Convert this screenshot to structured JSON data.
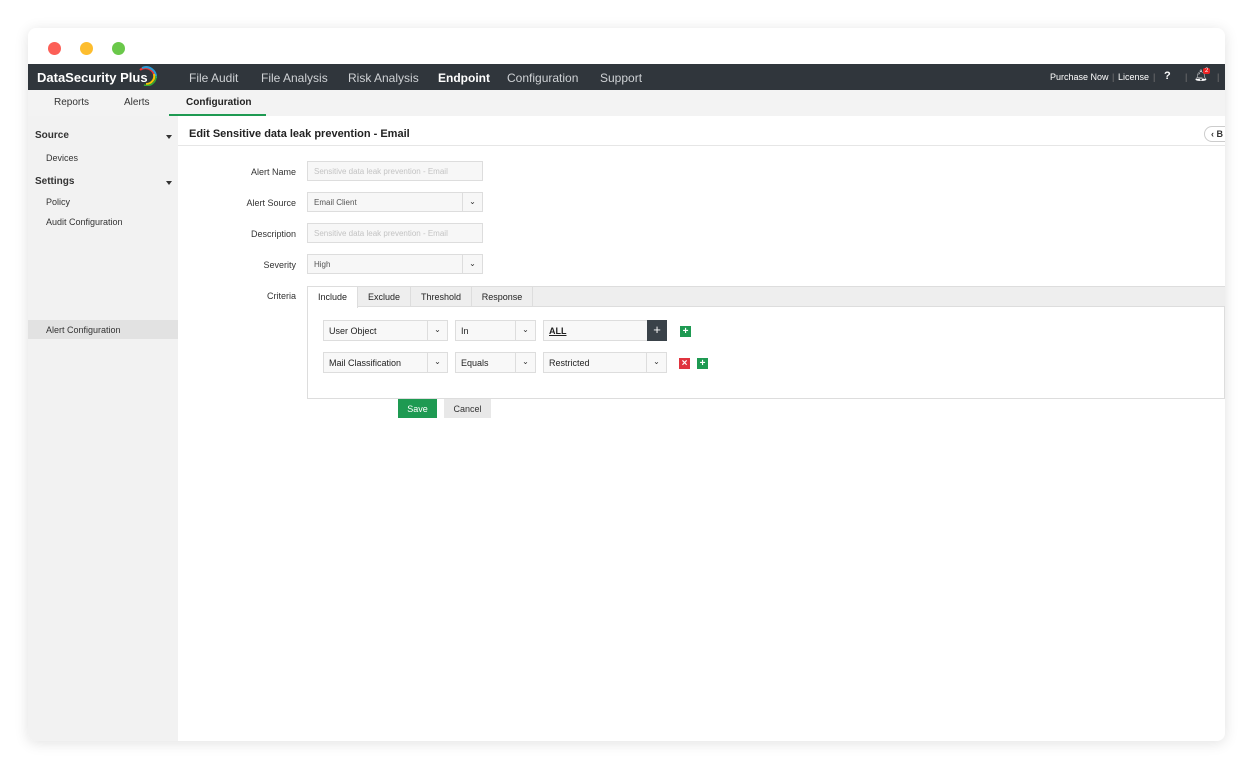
{
  "app": {
    "name": "DataSecurity Plus"
  },
  "nav": {
    "items": [
      "File Audit",
      "File Analysis",
      "Risk Analysis",
      "Endpoint",
      "Configuration",
      "Support"
    ],
    "active": "Endpoint",
    "purchase": "Purchase Now",
    "license": "License",
    "help": "?",
    "notification_count": "2"
  },
  "subnav": {
    "items": [
      "Reports",
      "Alerts",
      "Configuration"
    ],
    "active": "Configuration"
  },
  "sidebar": {
    "source": "Source",
    "devices": "Devices",
    "settings": "Settings",
    "policy": "Policy",
    "audit_config": "Audit Configuration",
    "alert_config": "Alert Configuration"
  },
  "page": {
    "title": "Edit Sensitive data leak prevention - Email",
    "back": "B"
  },
  "form": {
    "alert_name_label": "Alert Name",
    "alert_name_placeholder": "Sensitive data leak prevention - Email",
    "alert_source_label": "Alert Source",
    "alert_source_value": "Email Client",
    "description_label": "Description",
    "description_placeholder": "Sensitive data leak prevention - Email",
    "severity_label": "Severity",
    "severity_value": "High",
    "criteria_label": "Criteria"
  },
  "criteria": {
    "tabs": [
      "Include",
      "Exclude",
      "Threshold",
      "Response"
    ],
    "active_tab": "Include",
    "rows": [
      {
        "field": "User Object",
        "operator": "In",
        "value": "ALL"
      },
      {
        "field": "Mail Classification",
        "operator": "Equals",
        "value": "Restricted"
      }
    ]
  },
  "buttons": {
    "save": "Save",
    "cancel": "Cancel"
  },
  "colors": {
    "nav_bg": "#30363c",
    "accent": "#1e9a52",
    "remove": "#e0343f"
  }
}
